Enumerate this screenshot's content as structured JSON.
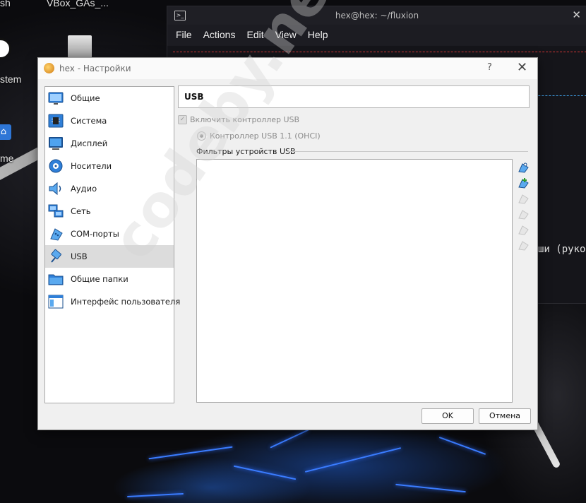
{
  "desktop": {
    "icons": [
      {
        "label": "sh"
      },
      {
        "label": "VBox_GAs_..."
      },
      {
        "label": "stem"
      },
      {
        "label": "me"
      }
    ]
  },
  "terminal": {
    "title": "hex@hex: ~/fluxion",
    "menu": [
      "File",
      "Actions",
      "Edit",
      "View",
      "Help"
    ],
    "visible_text": "ши (рукопо"
  },
  "dialog": {
    "title": "hex - Настройки",
    "help": "?",
    "close": "✕",
    "sidebar": {
      "items": [
        {
          "label": "Общие",
          "icon": "general-icon"
        },
        {
          "label": "Система",
          "icon": "system-icon"
        },
        {
          "label": "Дисплей",
          "icon": "display-icon"
        },
        {
          "label": "Носители",
          "icon": "storage-icon"
        },
        {
          "label": "Аудио",
          "icon": "audio-icon"
        },
        {
          "label": "Сеть",
          "icon": "network-icon"
        },
        {
          "label": "COM-порты",
          "icon": "serial-ports-icon"
        },
        {
          "label": "USB",
          "icon": "usb-icon",
          "selected": true
        },
        {
          "label": "Общие папки",
          "icon": "shared-folders-icon"
        },
        {
          "label": "Интерфейс пользователя",
          "icon": "user-interface-icon"
        }
      ]
    },
    "section": {
      "title": "USB",
      "enable_controller": {
        "label": "Включить контроллер USB",
        "checked": true,
        "enabled": false
      },
      "controller_option": {
        "label": "Контроллер USB 1.1 (OHCI)",
        "selected": true,
        "enabled": false
      },
      "filters_label": "Фильтры устройств USB",
      "filter_items": [],
      "tools": [
        "add-filter-icon",
        "add-from-device-icon",
        "edit-filter-icon",
        "remove-filter-icon",
        "move-up-icon",
        "move-down-icon"
      ]
    },
    "buttons": {
      "ok": "OK",
      "cancel": "Отмена"
    }
  },
  "watermark": "codeby.net",
  "colors": {
    "dialog_bg": "#f0f0f0",
    "selected_item": "#dcdcdc",
    "terminal_bg": "#1c1c22",
    "disabled_text": "#8a8a8a",
    "accent_blue": "#3a7cff"
  }
}
